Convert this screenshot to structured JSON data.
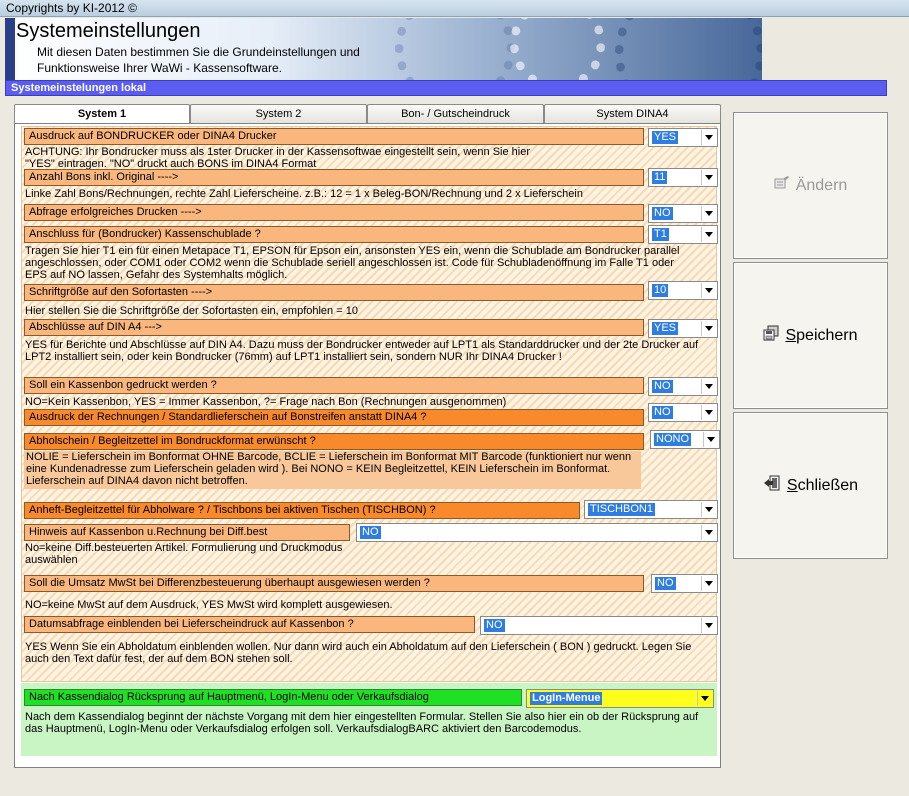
{
  "window": {
    "title": "Copyrights by KI-2012 ©"
  },
  "banner": {
    "heading": "Systemeinstellungen",
    "sub1": "Mit diesen Daten bestimmen Sie die Grundeinstellungen und",
    "sub2": "Funktionsweise Ihrer WaWi - Kassensoftware."
  },
  "section": {
    "title": "Systemeinstelungen lokal"
  },
  "tabs": [
    "System 1",
    "System 2",
    "Bon- / Gutscheindruck",
    "System DINA4"
  ],
  "settings": [
    {
      "label": "Ausdruck auf BONDRUCKER oder DINA4 Drucker",
      "value": "YES",
      "desc": "ACHTUNG: Ihr Bondrucker muss als 1ster Drucker in der Kassensoftwae  eingestellt sein, wenn Sie hier \"YES\" eintragen. \"NO\" druckt auch BONS im DINA4  Format"
    },
    {
      "label": "Anzahl Bons inkl. Original ---->",
      "value": "11",
      "desc": "Linke Zahl Bons/Rechnungen, rechte Zahl Lieferscheine. z.B.: 12 = 1 x Beleg-BON/Rechnung und  2 x Lieferschein"
    },
    {
      "label": "Abfrage erfolgreiches Drucken ---->",
      "value": "NO",
      "desc": ""
    },
    {
      "label": "Anschluss für (Bondrucker) Kassenschublade ?",
      "value": "T1",
      "desc": "Tragen Sie hier T1 ein für einen Metapace T1, EPSON für Epson  ein, ansonsten YES ein, wenn die Schublade am Bondrucker parallel angeschlossen, oder COM1 oder COM2 wenn die Schublade seriell angeschlossen ist. Code für Schubladenöffnung im Falle T1 oder EPS auf NO lassen, Gefahr des Systemhalts möglich."
    },
    {
      "label": "Schriftgröße auf den Sofortasten ---->",
      "value": "10",
      "desc": "Hier stellen Sie die Schriftgröße der Sofortasten ein, empfohlen = 10"
    },
    {
      "label": "Abschlüsse auf DIN A4         --->",
      "value": "YES",
      "desc": "YES für Berichte und Abschlüsse auf DIN A4.  Dazu muss der Bondrucker entweder auf LPT1 als Standarddrucker und der 2te Drucker auf LPT2 installiert sein, oder kein Bondrucker (76mm) auf LPT1 installiert sein, sondern NUR Ihr DINA4 Drucker  !"
    },
    {
      "label": "Soll ein  Kassenbon gedruckt werden ?",
      "value": "NO",
      "desc": "NO=Kein Kassenbon, YES = Immer Kassenbon,  ?= Frage nach Bon  (Rechnungen ausgenommen)"
    },
    {
      "label": "Ausdruck der Rechnungen / Standardlieferschein auf Bonstreifen anstatt DINA4 ?",
      "value": "NO",
      "desc": ""
    },
    {
      "label": "Abholschein / Begleitzettel im Bondruckformat erwünscht ?",
      "value": "NONO",
      "desc": "NOLIE = Lieferschein im Bonformat OHNE Barcode, BCLIE = Lieferschein im Bonformat MIT Barcode (funktioniert nur wenn eine Kundenadresse zum Lieferschein geladen wird ).  Bei NONO = KEIN Begleitzettel, KEIN Lieferschein im Bonformat. Lieferschein auf DINA4 davon nicht betroffen."
    },
    {
      "label": "Anheft-Begleitzettel für Abholware ? / Tischbons bei aktiven Tischen (TISCHBON) ?",
      "value": "TISCHBON1",
      "desc": ""
    },
    {
      "label": "Hinweis auf Kassenbon u.Rechnung bei Diff.best",
      "value": "NO",
      "desc": "No=keine Diff.besteuerten Artikel. Formulierung und Druckmodus auswählen"
    },
    {
      "label": "Soll die Umsatz MwSt bei Differenzbesteuerung überhaupt ausgewiesen werden ?",
      "value": "NO",
      "desc": "NO=keine MwSt auf dem Ausdruck, YES MwSt wird komplett ausgewiesen."
    },
    {
      "label": "Datumsabfrage einblenden bei Lieferscheindruck auf Kassenbon ?",
      "value": "NO",
      "desc": "YES Wenn Sie ein Abholdatum einblenden wollen. Nur dann wird auch ein Abholdatum auf den Lieferschein ( BON ) gedruckt. Legen Sie auch den Text dafür fest, der auf dem BON stehen soll."
    },
    {
      "label": "Nach Kassendialog Rücksprung auf Hauptmenü, LogIn-Menu oder Verkaufsdialog",
      "value": "LogIn-Menue",
      "desc": "Nach dem Kassendialog beginnt der nächste Vorgang mit dem hier eingestellten Formular. Stellen Sie also hier ein ob der Rücksprung auf das Hauptmenü, LogIn-Menu oder Verkaufsdialog erfolgen soll. VerkaufsdialogBARC aktiviert den Barcodemodus."
    }
  ],
  "buttons": {
    "edit": "Ändern",
    "save": "Speichern",
    "close": "Schließen"
  },
  "icons": {
    "edit": "edit-icon",
    "save": "save-icon",
    "close": "exit-icon"
  }
}
